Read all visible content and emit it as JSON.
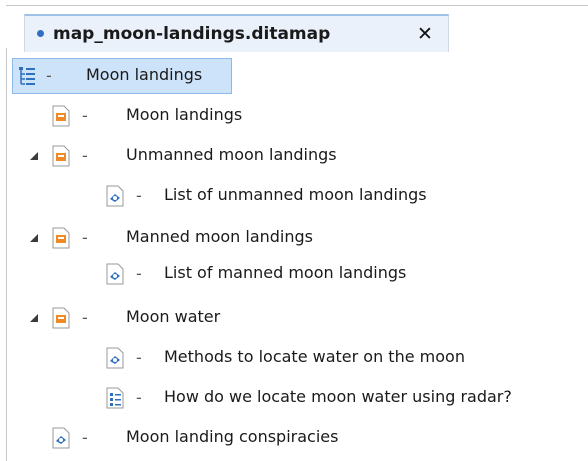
{
  "tab": {
    "title": "map_moon-landings.ditamap",
    "close_label": "✕"
  },
  "tree": {
    "separator": "-",
    "root": {
      "label": "Moon landings",
      "icon": "map-icon"
    },
    "items": [
      {
        "label": "Moon landings",
        "icon": "topic-icon"
      },
      {
        "label": "Unmanned moon landings",
        "icon": "topic-icon",
        "expanded": true
      },
      {
        "label": "List of unmanned moon landings",
        "icon": "reference-icon"
      },
      {
        "label": "Manned moon landings",
        "icon": "topic-icon",
        "expanded": true
      },
      {
        "label": "List of manned moon landings",
        "icon": "reference-icon"
      },
      {
        "label": "Moon water",
        "icon": "topic-icon",
        "expanded": true
      },
      {
        "label": "Methods to locate water on the moon",
        "icon": "reference-icon"
      },
      {
        "label": "How do we locate moon water using radar?",
        "icon": "task-icon"
      },
      {
        "label": "Moon landing conspiracies",
        "icon": "reference-icon"
      }
    ]
  },
  "colors": {
    "selection": "#cde3f9",
    "topic_icon": "#f08a24",
    "reference_icon": "#2f6fbf"
  }
}
